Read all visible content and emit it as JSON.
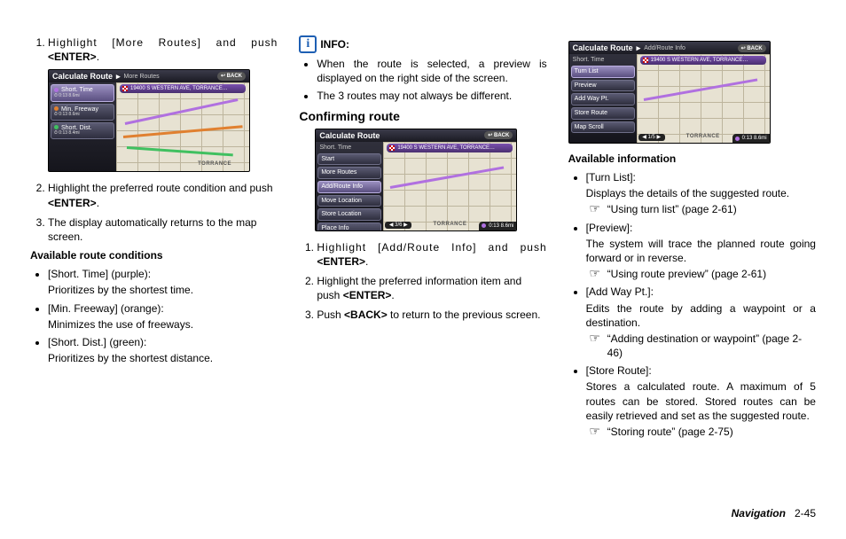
{
  "col1": {
    "step1": "Highlight [More Routes] and push ",
    "step1_key": "<ENTER>",
    "shot": {
      "title": "Calculate Route",
      "crumb": "More Routes",
      "back": "↩ BACK",
      "dest": "19400 S WESTERN AVE, TORRANCE…",
      "items": [
        {
          "label": "Short. Time",
          "meta": "⏱ 0:13   8.6mi"
        },
        {
          "label": "Min. Freeway",
          "meta": "⏱ 0:13   8.6mi"
        },
        {
          "label": "Short. Dist.",
          "meta": "⏱ 0:13   8.4mi"
        }
      ],
      "torrance": "TORRANCE"
    },
    "step2": "Highlight the preferred route condition and push ",
    "step2_key": "<ENTER>",
    "step3": "The display automatically returns to the map screen.",
    "cond_head": "Available route conditions",
    "conds": [
      {
        "label": "[Short. Time] (purple):",
        "desc": "Prioritizes by the shortest time."
      },
      {
        "label": "[Min. Freeway] (orange):",
        "desc": "Minimizes the use of freeways."
      },
      {
        "label": "[Short. Dist.] (green):",
        "desc": "Prioritizes by the shortest distance."
      }
    ]
  },
  "col2": {
    "info_label": "INFO:",
    "info_items": [
      "When the route is selected, a preview is displayed on the right side of the screen.",
      "The 3 routes may not always be different."
    ],
    "section": "Confirming route",
    "shot": {
      "title": "Calculate Route",
      "back": "↩ BACK",
      "side_top": "Short. Time",
      "dest": "19400 S WESTERN AVE, TORRANCE…",
      "items": [
        "Start",
        "More Routes",
        "Add/Route Info",
        "Move Location",
        "Store Location",
        "Place Info"
      ],
      "pager": "◀ 3/6 ▶",
      "torrance": "TORRANCE",
      "eta": "0:13   8.6mi"
    },
    "step1": "Highlight [Add/Route Info] and push ",
    "step1_key": "<ENTER>",
    "step2": "Highlight the preferred information item and push ",
    "step2_key": "<ENTER>",
    "step3a": "Push ",
    "step3_key": "<BACK>",
    "step3b": " to return to the previous screen."
  },
  "col3": {
    "shot": {
      "title": "Calculate Route",
      "crumb": "Add/Route Info",
      "back": "↩ BACK",
      "side_top": "Short. Time",
      "dest": "19400 S WESTERN AVE, TORRANCE…",
      "items": [
        "Turn List",
        "Preview",
        "Add Way Pt.",
        "Store Route",
        "Map Scroll"
      ],
      "pager": "◀ 1/5 ▶",
      "torrance": "TORRANCE",
      "eta": "0:13   8.6mi"
    },
    "head": "Available information",
    "items": [
      {
        "label": "[Turn List]:",
        "desc": "Displays the details of the suggested route.",
        "ref": "“Using turn list” (page 2-61)"
      },
      {
        "label": "[Preview]:",
        "desc": "The system will trace the planned route going forward or in reverse.",
        "ref": "“Using route preview” (page 2-61)"
      },
      {
        "label": "[Add Way Pt.]:",
        "desc": "Edits the route by adding a waypoint or a destination.",
        "ref": "“Adding destination or waypoint” (page 2-46)"
      },
      {
        "label": "[Store Route]:",
        "desc": "Stores a calculated route. A maximum of 5 routes can be stored. Stored routes can be easily retrieved and set as the suggested route.",
        "ref": "“Storing route” (page 2-75)"
      }
    ]
  },
  "footer": {
    "section": "Navigation",
    "page": "2-45"
  },
  "ref_icon": "☞"
}
